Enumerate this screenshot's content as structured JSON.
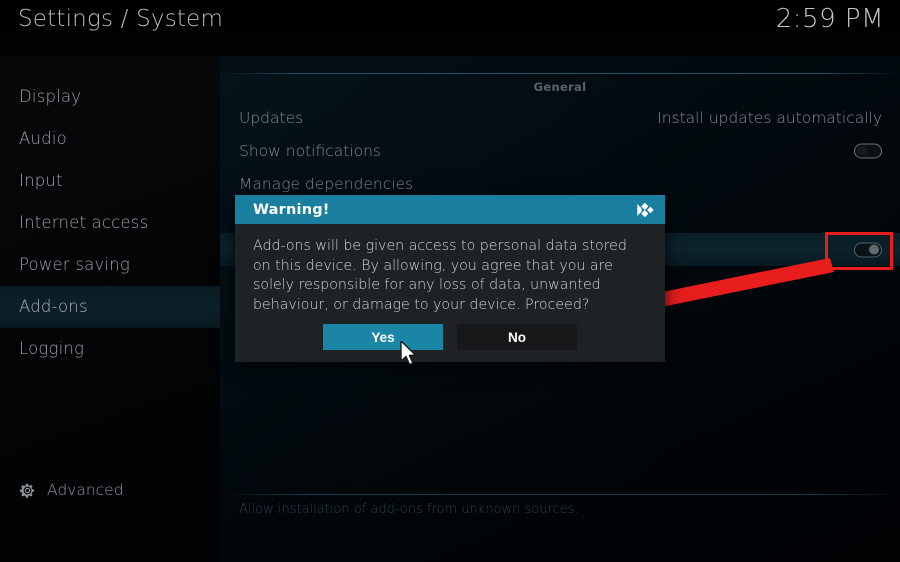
{
  "header": {
    "title": "Settings / System",
    "clock": "2:59 PM"
  },
  "sidebar": {
    "items": [
      {
        "label": "Display",
        "selected": false
      },
      {
        "label": "Audio",
        "selected": false
      },
      {
        "label": "Input",
        "selected": false
      },
      {
        "label": "Internet access",
        "selected": false
      },
      {
        "label": "Power saving",
        "selected": false
      },
      {
        "label": "Add-ons",
        "selected": true
      },
      {
        "label": "Logging",
        "selected": false
      }
    ],
    "advanced": {
      "label": "Advanced",
      "icon": "gear-icon"
    }
  },
  "content": {
    "group_label": "General",
    "rows": [
      {
        "label": "Updates",
        "value": "Install updates automatically",
        "control": "text"
      },
      {
        "label": "Show notifications",
        "value": "",
        "control": "toggle",
        "toggle_state": "off"
      },
      {
        "label": "Manage dependencies",
        "value": "",
        "control": "none"
      },
      {
        "label": "",
        "value": "",
        "control": "none"
      },
      {
        "label": "",
        "value": "",
        "control": "toggle",
        "toggle_state": "on"
      }
    ],
    "description": "Allow installation of add-ons from unknown sources."
  },
  "dialog": {
    "title": "Warning!",
    "logo_icon": "kodi-logo-icon",
    "message": "Add-ons will be given access to personal data stored on this device. By allowing, you agree that you are solely responsible for any loss of data, unwanted behaviour, or damage to your device. Proceed?",
    "buttons": {
      "yes": "Yes",
      "no": "No"
    }
  },
  "annotations": {
    "highlight_box": "toggle-highlight",
    "arrow": "pointer-arrow",
    "cursor": "mouse-cursor"
  },
  "colors": {
    "accent_teal": "#1a85a5",
    "header_teal": "#1a7f9e",
    "annotation_red": "#e81d1d",
    "dialog_bg": "#1e2225",
    "selected_row": "#0c232c"
  }
}
